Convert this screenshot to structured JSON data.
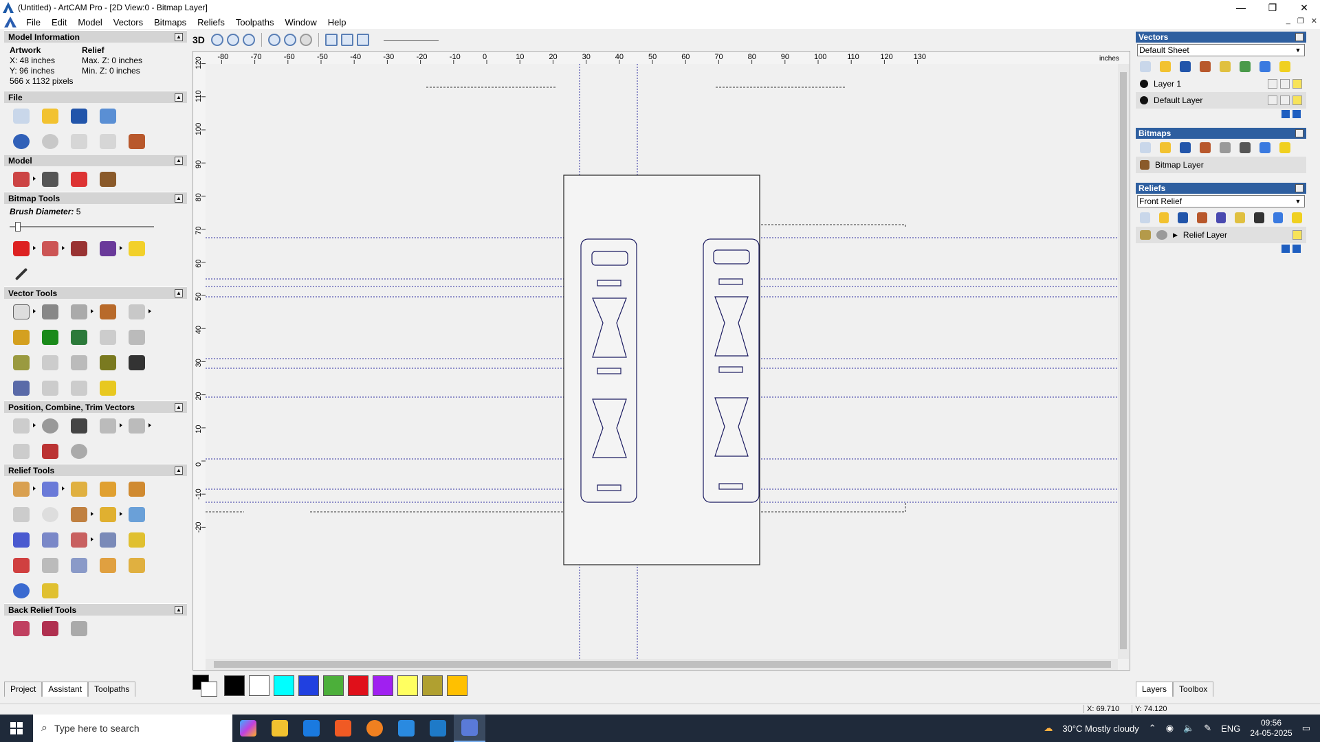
{
  "window": {
    "title": "(Untitled) - ArtCAM Pro - [2D View:0 - Bitmap Layer]",
    "controls": [
      "—",
      "❐",
      "✕"
    ]
  },
  "menu": [
    "File",
    "Edit",
    "Model",
    "Vectors",
    "Bitmaps",
    "Reliefs",
    "Toolpaths",
    "Window",
    "Help"
  ],
  "left": {
    "model_info": {
      "header": "Model Information",
      "artwork_label": "Artwork",
      "relief_label": "Relief",
      "x": "X: 48 inches",
      "y": "Y: 96 inches",
      "pixels": "566 x 1132 pixels",
      "maxz": "Max. Z: 0 inches",
      "minz": "Min. Z: 0 inches"
    },
    "file_header": "File",
    "model_header": "Model",
    "bitmap_tools_header": "Bitmap Tools",
    "brush_label": "Brush Diameter:",
    "brush_value": "5",
    "vector_tools_header": "Vector Tools",
    "position_header": "Position, Combine, Trim Vectors",
    "relief_tools_header": "Relief Tools",
    "back_relief_header": "Back Relief Tools",
    "tabs": [
      "Project",
      "Assistant",
      "Toolpaths"
    ]
  },
  "toolbar": {
    "label_3d": "3D"
  },
  "canvas": {
    "unit": "inches",
    "hticks": [
      -80,
      -70,
      -60,
      -50,
      -40,
      -30,
      -20,
      -10,
      0,
      10,
      20,
      30,
      40,
      50,
      60,
      70,
      80,
      90,
      100,
      110,
      120,
      130
    ],
    "vticks": [
      120,
      110,
      100,
      90,
      80,
      70,
      60,
      50,
      40,
      30,
      20,
      10,
      0,
      -10,
      -20
    ]
  },
  "right": {
    "vectors_header": "Vectors",
    "vectors_sheet": "Default Sheet",
    "layers": [
      "Layer 1",
      "Default Layer"
    ],
    "bitmaps_header": "Bitmaps",
    "bitmap_layer": "Bitmap Layer",
    "reliefs_header": "Reliefs",
    "relief_select": "Front Relief",
    "relief_layer": "Relief Layer",
    "tabs": [
      "Layers",
      "Toolbox"
    ]
  },
  "colors": [
    "#000000",
    "#ffffff",
    "#00ffff",
    "#2040e0",
    "#4caf3a",
    "#e0101a",
    "#a020f0",
    "#ffff60",
    "#b0a030",
    "#ffc000"
  ],
  "status": {
    "x": "X: 69.710",
    "y": "Y: 74.120"
  },
  "taskbar": {
    "search_placeholder": "Type here to search",
    "weather": "30°C  Mostly cloudy",
    "lang": "ENG",
    "time": "09:56",
    "date": "24-05-2025"
  }
}
